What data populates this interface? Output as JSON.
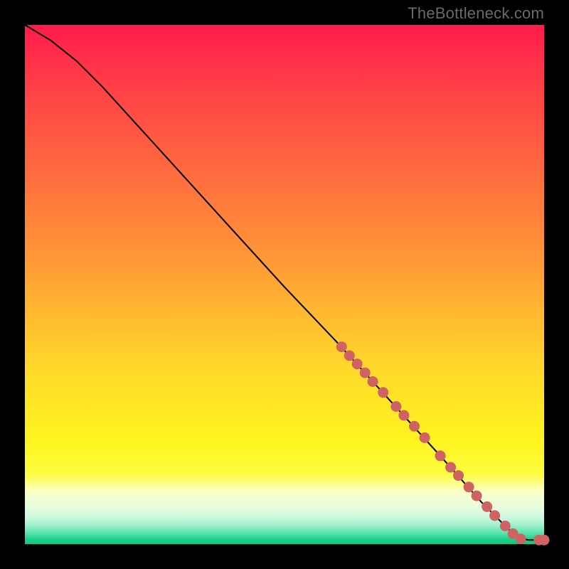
{
  "attribution": "TheBottleneck.com",
  "colors": {
    "dot": "#cf6262",
    "curve": "#000000",
    "background_top": "#ff1b4b",
    "background_mid": "#ffe824",
    "background_bottom": "#0ec77f",
    "frame": "#000000"
  },
  "chart_data": {
    "type": "line",
    "title": "",
    "xlabel": "",
    "ylabel": "",
    "xlim": [
      0,
      100
    ],
    "ylim": [
      0,
      100
    ],
    "curve": [
      {
        "x": 0,
        "y": 100
      },
      {
        "x": 5,
        "y": 97
      },
      {
        "x": 10,
        "y": 93
      },
      {
        "x": 15,
        "y": 88
      },
      {
        "x": 20,
        "y": 82.5
      },
      {
        "x": 30,
        "y": 71.5
      },
      {
        "x": 40,
        "y": 60.5
      },
      {
        "x": 50,
        "y": 49.5
      },
      {
        "x": 60,
        "y": 39
      },
      {
        "x": 70,
        "y": 28
      },
      {
        "x": 80,
        "y": 17
      },
      {
        "x": 88,
        "y": 8
      },
      {
        "x": 93,
        "y": 3
      },
      {
        "x": 95,
        "y": 1.2
      },
      {
        "x": 97,
        "y": 0.8
      },
      {
        "x": 100,
        "y": 0.8
      }
    ],
    "series": [
      {
        "name": "highlighted-points",
        "points": [
          {
            "x": 61,
            "y": 38
          },
          {
            "x": 62.5,
            "y": 36.3
          },
          {
            "x": 64,
            "y": 34.7
          },
          {
            "x": 65.5,
            "y": 33
          },
          {
            "x": 67,
            "y": 31.3
          },
          {
            "x": 69,
            "y": 29.2
          },
          {
            "x": 71.5,
            "y": 26.5
          },
          {
            "x": 73,
            "y": 24.8
          },
          {
            "x": 75,
            "y": 22.7
          },
          {
            "x": 77,
            "y": 20.5
          },
          {
            "x": 80,
            "y": 17
          },
          {
            "x": 82,
            "y": 14.8
          },
          {
            "x": 83.5,
            "y": 13.2
          },
          {
            "x": 85.5,
            "y": 11
          },
          {
            "x": 87,
            "y": 9.3
          },
          {
            "x": 89,
            "y": 7.2
          },
          {
            "x": 90.5,
            "y": 5.5
          },
          {
            "x": 92.5,
            "y": 3.5
          },
          {
            "x": 94,
            "y": 2
          },
          {
            "x": 95.5,
            "y": 1
          },
          {
            "x": 99,
            "y": 0.8
          },
          {
            "x": 100,
            "y": 0.8
          }
        ]
      }
    ]
  }
}
